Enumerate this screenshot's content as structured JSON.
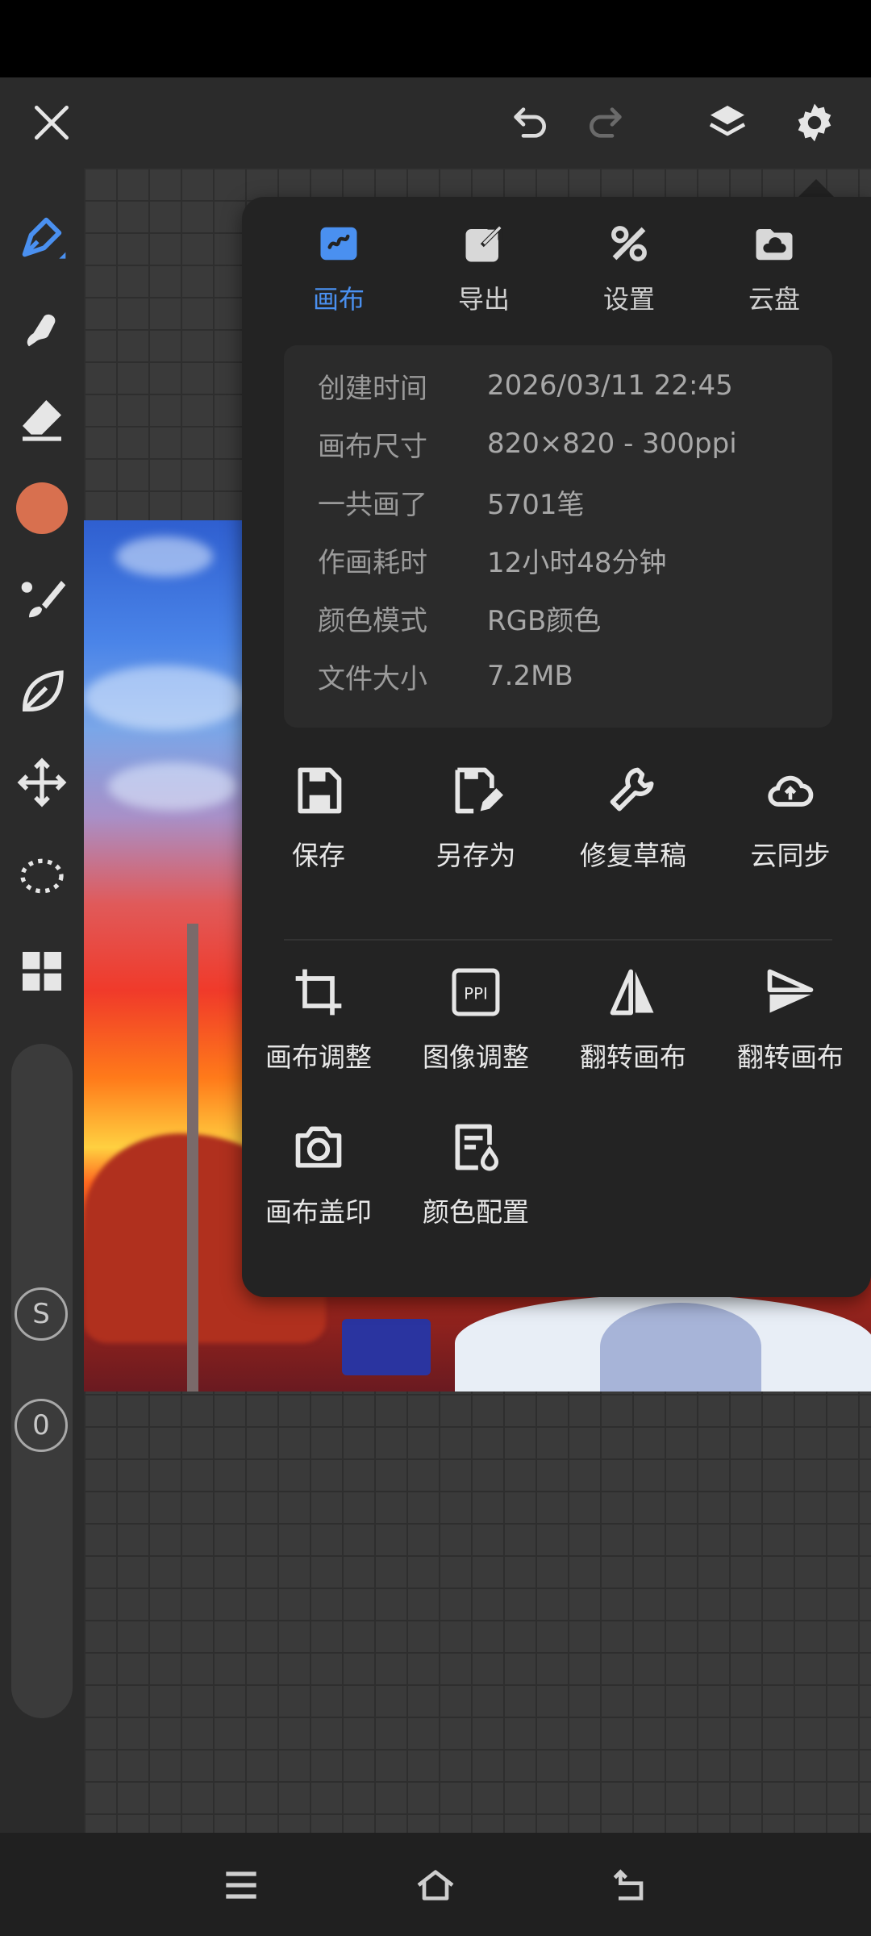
{
  "colors": {
    "accent": "#4a90f0",
    "brush_color": "#d8704f",
    "panel_bg": "#232323",
    "toolbar_bg": "#2b2b2b"
  },
  "topbar": {
    "icons": [
      "close-icon",
      "undo-icon",
      "redo-icon",
      "layers-icon",
      "settings-icon"
    ]
  },
  "toolbar": {
    "icons": [
      "pen-icon",
      "smudge-icon",
      "eraser-icon",
      "color-picker",
      "brush-icon",
      "leaf-icon",
      "move-icon",
      "lasso-icon",
      "grid-icon"
    ],
    "slider_labels": [
      "S",
      "0"
    ]
  },
  "panel": {
    "tabs": [
      {
        "label": "画布",
        "icon": "canvas-icon",
        "active": true
      },
      {
        "label": "导出",
        "icon": "export-icon",
        "active": false
      },
      {
        "label": "设置",
        "icon": "tools-icon",
        "active": false
      },
      {
        "label": "云盘",
        "icon": "cloud-drive-icon",
        "active": false
      }
    ],
    "info": [
      {
        "key": "创建时间",
        "value": "2026/03/11 22:45"
      },
      {
        "key": "画布尺寸",
        "value": "820×820 - 300ppi"
      },
      {
        "key": "一共画了",
        "value": "5701笔"
      },
      {
        "key": "作画耗时",
        "value": "12小时48分钟"
      },
      {
        "key": "颜色模式",
        "value": "RGB颜色"
      },
      {
        "key": "文件大小",
        "value": "7.2MB"
      }
    ],
    "actions_row1": [
      {
        "label": "保存",
        "icon": "save-icon"
      },
      {
        "label": "另存为",
        "icon": "save-as-icon"
      },
      {
        "label": "修复草稿",
        "icon": "wrench-icon"
      },
      {
        "label": "云同步",
        "icon": "cloud-sync-icon"
      }
    ],
    "actions_row2": [
      {
        "label": "画布调整",
        "icon": "crop-icon"
      },
      {
        "label": "图像调整",
        "icon": "ppi-icon",
        "icon_text": "PPI"
      },
      {
        "label": "翻转画布",
        "icon": "flip-horizontal-icon"
      },
      {
        "label": "翻转画布",
        "icon": "flip-vertical-icon"
      }
    ],
    "actions_row3": [
      {
        "label": "画布盖印",
        "icon": "camera-icon"
      },
      {
        "label": "颜色配置",
        "icon": "color-profile-icon"
      }
    ]
  },
  "navbar": {
    "icons": [
      "menu-icon",
      "home-icon",
      "back-icon"
    ]
  }
}
